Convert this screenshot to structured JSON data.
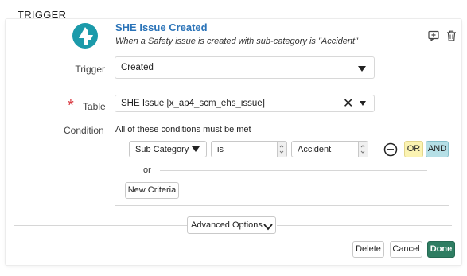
{
  "section": {
    "title": "TRIGGER"
  },
  "header": {
    "title": "SHE Issue Created",
    "subtitle": "When a Safety issue is created with sub-category is \"Accident\"",
    "icons": [
      "comment-icon",
      "trash-icon"
    ]
  },
  "trigger": {
    "label": "Trigger",
    "value": "Created"
  },
  "table": {
    "required_marker": "*",
    "label": "Table",
    "value": "SHE Issue [x_ap4_scm_ehs_issue]"
  },
  "condition": {
    "label": "Condition",
    "description": "All of these conditions must be met",
    "field": "Sub Category",
    "operator": "is",
    "value": "Accident",
    "or_label": "OR",
    "and_label": "AND",
    "separator_label": "or",
    "new_criteria_label": "New Criteria"
  },
  "advanced": {
    "label": "Advanced Options"
  },
  "footer": {
    "delete_label": "Delete",
    "cancel_label": "Cancel",
    "done_label": "Done"
  },
  "colors": {
    "title": "#2a73b8",
    "required": "#d9363e",
    "or_button": "#fbf3b2",
    "and_button": "#b5dfe6",
    "done_button": "#2e7d62",
    "logo": "#1b9aaa"
  }
}
